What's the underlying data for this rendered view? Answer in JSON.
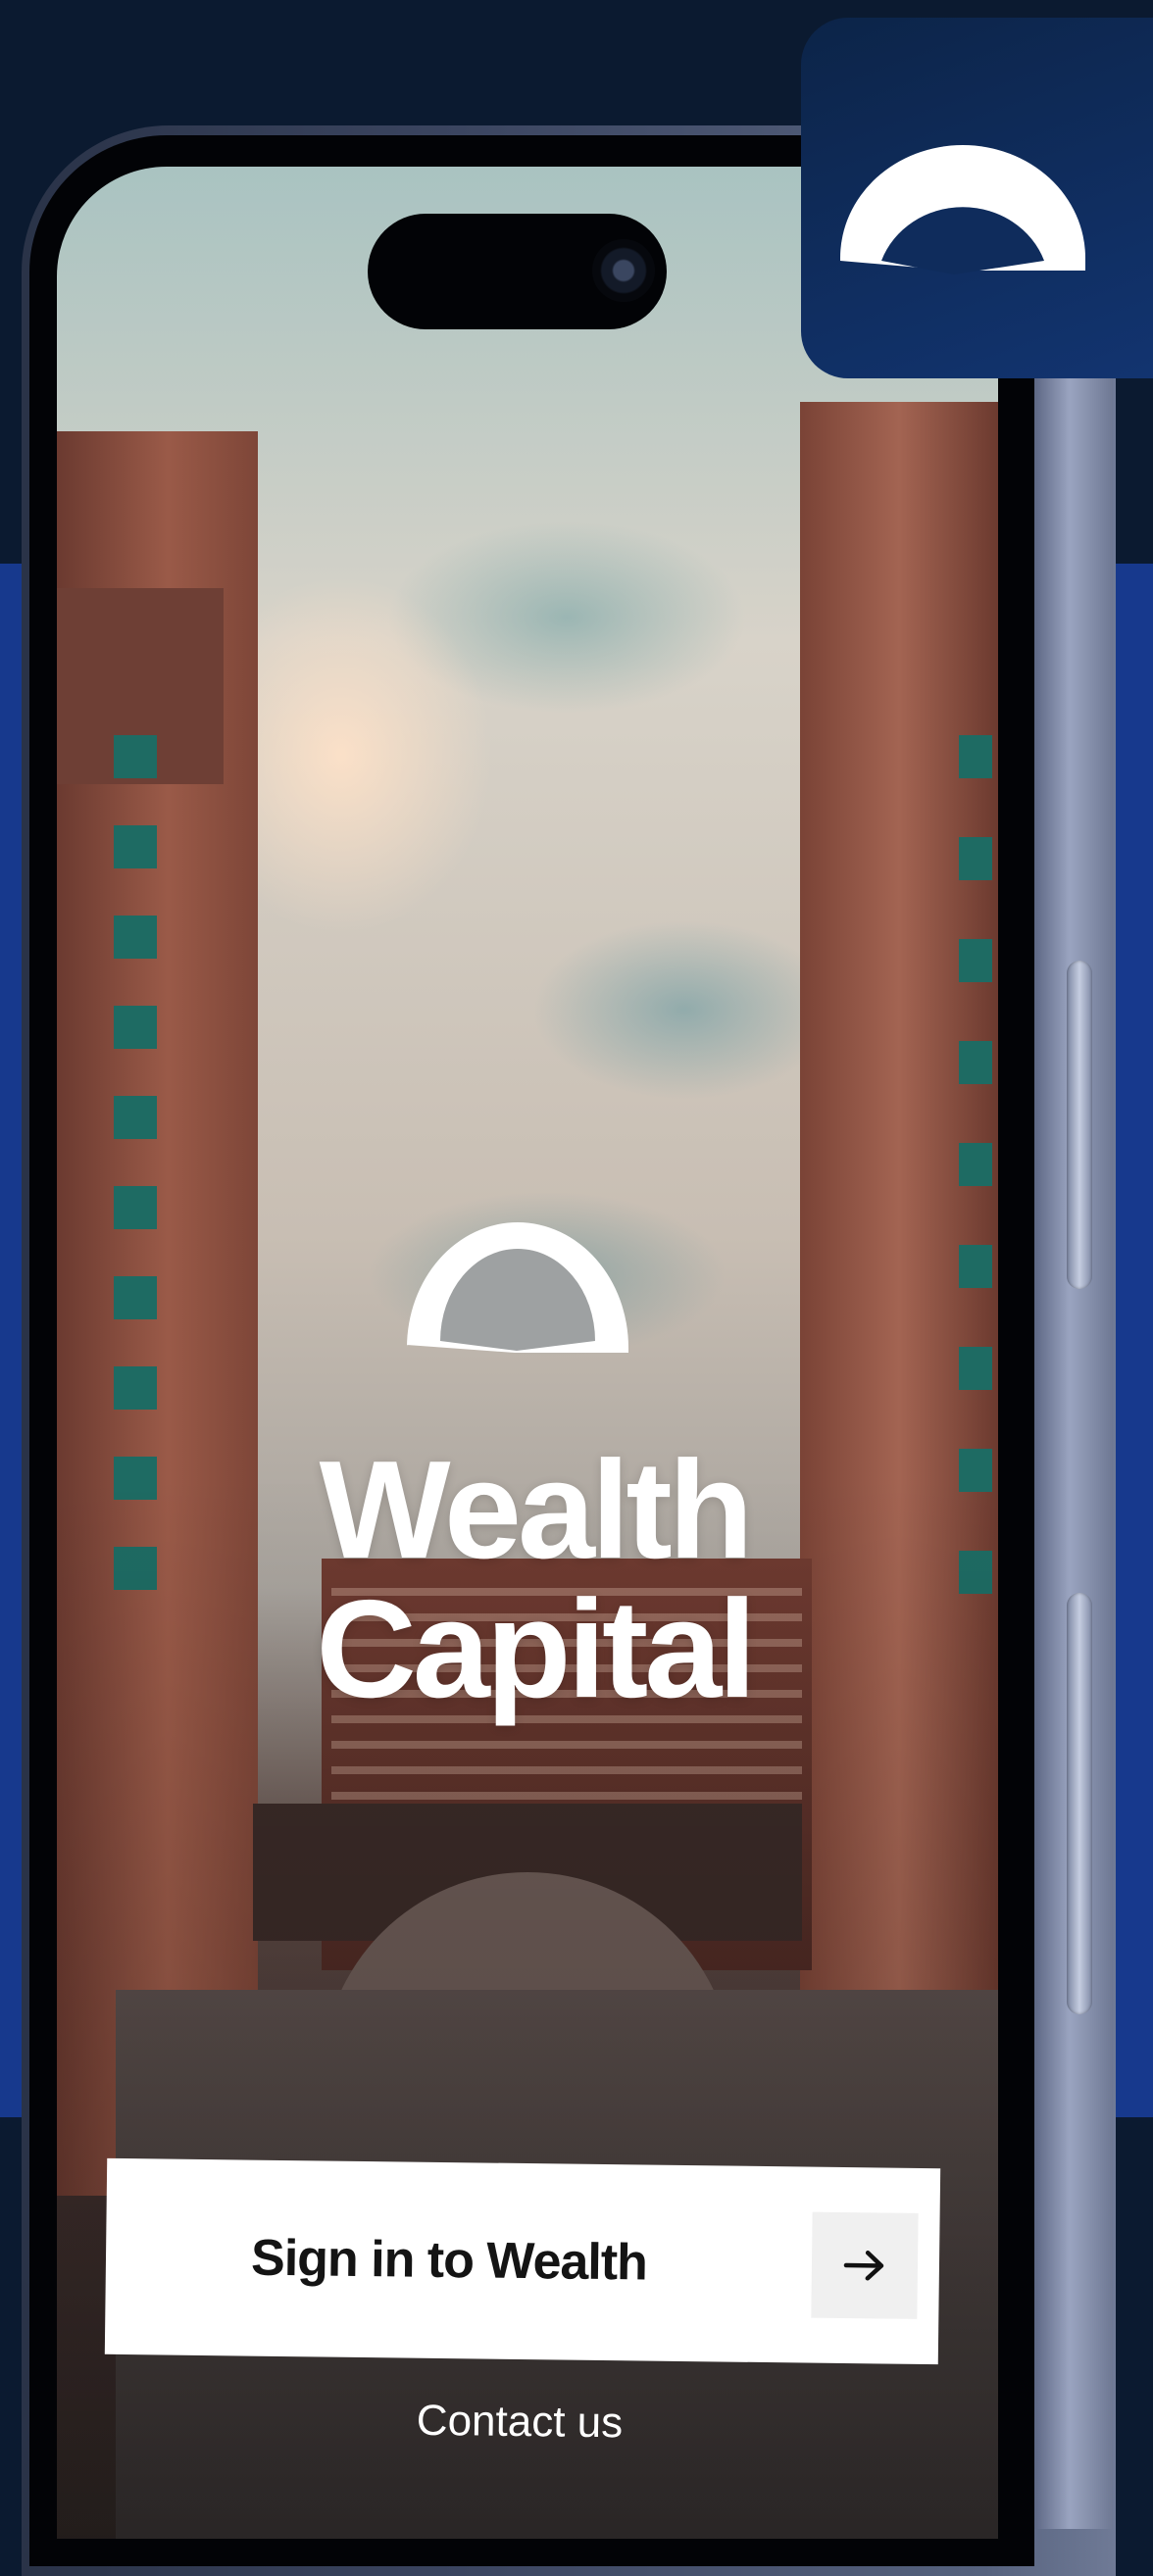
{
  "brand": {
    "name": "Wealth Capital",
    "logo_icon": "half-dome-logo-icon",
    "accent_color": "#17398d",
    "background_color": "#0b1a30"
  },
  "actions": {
    "signin_label": "Sign in to Wealth",
    "signin_arrow_icon": "arrow-right-icon",
    "contact_label": "Contact us"
  }
}
